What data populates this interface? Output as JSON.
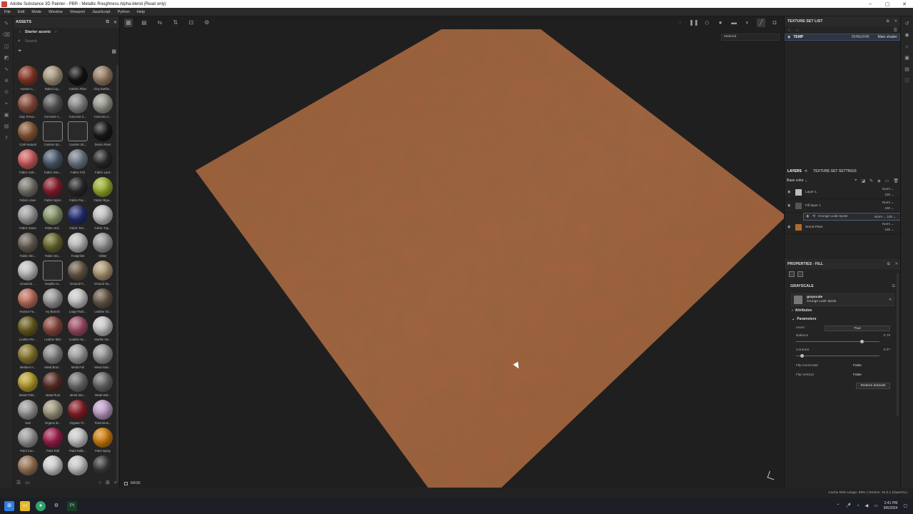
{
  "window": {
    "title": "Adobe Substance 3D Painter - PBR - Metallic Roughness Alpha-blend (Read only)",
    "controls": [
      "–",
      "▢",
      "✕"
    ]
  },
  "menu": [
    "File",
    "Edit",
    "Mode",
    "Window",
    "Viewport",
    "JavaScript",
    "Python",
    "Help"
  ],
  "assets": {
    "title": "ASSETS",
    "breadcrumb": "Starter assets",
    "search_placeholder": "Search",
    "items": [
      {
        "label": "Autumn L...",
        "color": "#8b3a2a"
      },
      {
        "label": "Baked Lig...",
        "color": "#a89a80"
      },
      {
        "label": "Carbon Fiber",
        "color": "#151515"
      },
      {
        "label": "Clay Earthe...",
        "color": "#9a8068"
      },
      {
        "label": "Clay Terrac...",
        "color": "#8a5040"
      },
      {
        "label": "Concrete A...",
        "color": "#5a5a5a"
      },
      {
        "label": "Concrete C...",
        "color": "#8a8a8a"
      },
      {
        "label": "Concrete C...",
        "color": "#9a9a92"
      },
      {
        "label": "Cork Natural",
        "color": "#8a5a38"
      },
      {
        "label": "Custom Sp...",
        "color": "#cfcfcf"
      },
      {
        "label": "Custom Sti...",
        "color": "#cfcfcf"
      },
      {
        "label": "Denim Rivet",
        "color": "#1a1a1a"
      },
      {
        "label": "Fabric Cott...",
        "color": "#d06060"
      },
      {
        "label": "Fabric Den...",
        "color": "#4e5e70"
      },
      {
        "label": "Fabric Felt",
        "color": "#707a86"
      },
      {
        "label": "Fabric Lace",
        "color": "#2a2a2a"
      },
      {
        "label": "Fabric Linen",
        "color": "#7a7670"
      },
      {
        "label": "Fabric Nylon",
        "color": "#8a2030"
      },
      {
        "label": "Fabric Puc...",
        "color": "#2a2a2a"
      },
      {
        "label": "Fabric Ripa...",
        "color": "#9ab030"
      },
      {
        "label": "Fabric Seam",
        "color": "#a0a0a0"
      },
      {
        "label": "Fabric Sof...",
        "color": "#8a9a70"
      },
      {
        "label": "Fabric Terr...",
        "color": "#243070"
      },
      {
        "label": "Fabric Top...",
        "color": "#c4c4c4"
      },
      {
        "label": "Fabric Wo...",
        "color": "#6a6258"
      },
      {
        "label": "Fabric Wo...",
        "color": "#6a6a30"
      },
      {
        "label": "Footprints",
        "color": "#bdbdbd"
      },
      {
        "label": "Glitter",
        "color": "#9a9a9a"
      },
      {
        "label": "Gouache ...",
        "color": "#c0c0c0"
      },
      {
        "label": "Graphic to...",
        "color": "#cfcfcf"
      },
      {
        "label": "Ground Fi...",
        "color": "#6a5a48"
      },
      {
        "label": "Ground Sa...",
        "color": "#b09a78"
      },
      {
        "label": "Human Fa...",
        "color": "#c07060"
      },
      {
        "label": "Ivy Branch",
        "color": "#9a9a9a"
      },
      {
        "label": "Large Rust...",
        "color": "#c8c8c8"
      },
      {
        "label": "Leather Gr...",
        "color": "#6a5a48"
      },
      {
        "label": "Leather Re...",
        "color": "#6a6020"
      },
      {
        "label": "Leather Skin",
        "color": "#8a4a40"
      },
      {
        "label": "Leather Su...",
        "color": "#a05068"
      },
      {
        "label": "Marble Vei...",
        "color": "#c8c8c8"
      },
      {
        "label": "Medium A...",
        "color": "#8a7a30"
      },
      {
        "label": "Metal Brus...",
        "color": "#8a8a8a"
      },
      {
        "label": "Metal Foil",
        "color": "#a0a0a0"
      },
      {
        "label": "Metal Galv...",
        "color": "#9a9a9a"
      },
      {
        "label": "Metal Polis...",
        "color": "#b8a030"
      },
      {
        "label": "Metal Rust",
        "color": "#5a3028"
      },
      {
        "label": "Metal San...",
        "color": "#707070"
      },
      {
        "label": "Metal Wal...",
        "color": "#6a6a6a"
      },
      {
        "label": "Nail",
        "color": "#9a9a9a"
      },
      {
        "label": "Organic B...",
        "color": "#a09880"
      },
      {
        "label": "Organic Fl...",
        "color": "#8a2028"
      },
      {
        "label": "Paint Brus...",
        "color": "#c0a0c8"
      },
      {
        "label": "Paint Cuc...",
        "color": "#9a9a9a"
      },
      {
        "label": "Paint Roll",
        "color": "#a02050"
      },
      {
        "label": "Paint Rolle...",
        "color": "#c8c8c8"
      },
      {
        "label": "Paint Spray",
        "color": "#d08010"
      },
      {
        "label": "",
        "color": "#9a7858"
      },
      {
        "label": "",
        "color": "#d0d0d0"
      },
      {
        "label": "",
        "color": "#c8c8c8"
      },
      {
        "label": "",
        "color": "#3a3a3a"
      }
    ]
  },
  "viewport": {
    "material_select": "Material",
    "mask_label": "MASK"
  },
  "texture_set_list": {
    "title": "TEXTURE SET LIST",
    "row": {
      "name": "TEMP",
      "resolution": "2048x2048",
      "shader": "Main shader"
    }
  },
  "layers": {
    "tab_layers": "LAYERS",
    "tab_settings": "TEXTURE SET SETTINGS",
    "channel": "Base color",
    "items": [
      {
        "name": "Layer 1",
        "blend": "Norm",
        "opacity": "100",
        "color": "#bdbdbd"
      },
      {
        "name": "Fill layer 1",
        "blend": "Norm",
        "opacity": "100",
        "color": "#555555"
      },
      {
        "name": "Wood Plain",
        "blend": "Norm",
        "opacity": "100",
        "color": "#b06a30"
      }
    ],
    "mask": {
      "name": "Grunge Leak Spots",
      "blend": "Norm",
      "opacity": "100"
    }
  },
  "properties": {
    "title": "PROPERTIES - FILL",
    "section": "GRAYSCALE",
    "resource": {
      "name": "grayscale",
      "source": "Grunge Leak Spots"
    },
    "attributes_label": "Attributes",
    "parameters_label": "Parameters",
    "invert": {
      "label": "Invert",
      "value": "True"
    },
    "balance": {
      "label": "Balance",
      "value": "0.79"
    },
    "contrast": {
      "label": "Contrast",
      "value": "0.07"
    },
    "flip_h": {
      "label": "Flip Horizontal",
      "value": "False"
    },
    "flip_v": {
      "label": "Flip Vertical",
      "value": "False"
    },
    "restore": "Restore defaults"
  },
  "status": "Cache Disk Usage:  96% | Version: 10.0.1 (OpenGL)",
  "taskbar": {
    "time": "2:41 PM",
    "date": "8/6/2024"
  }
}
